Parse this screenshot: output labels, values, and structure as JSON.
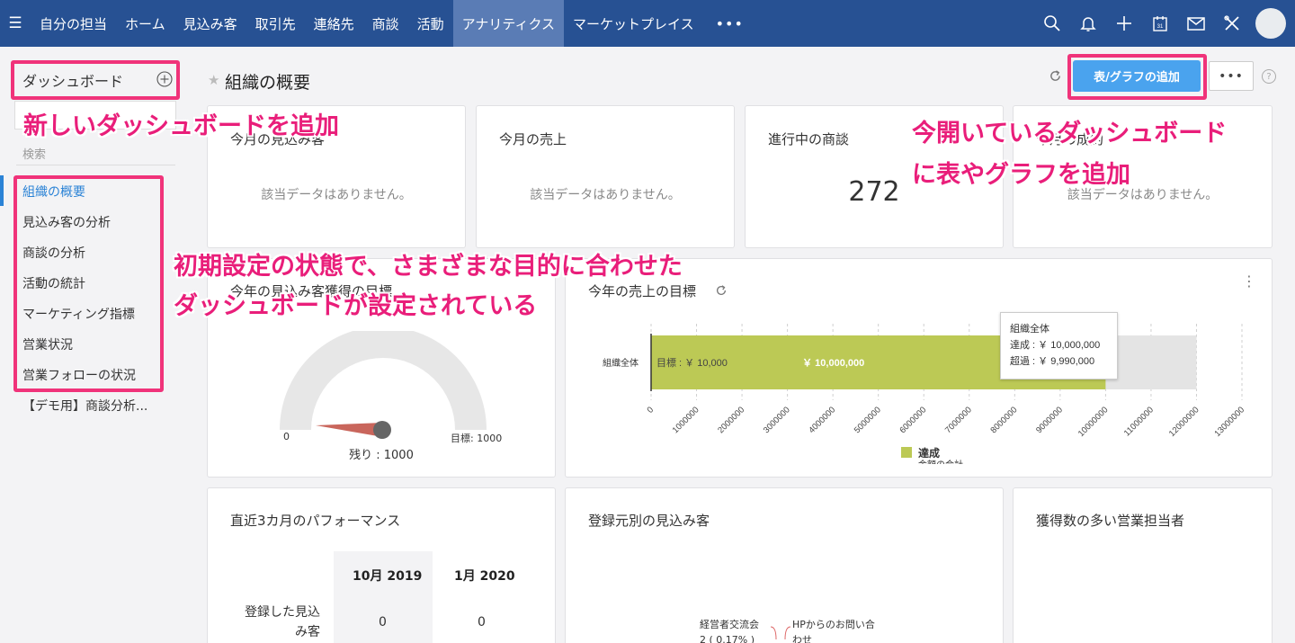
{
  "nav": {
    "items": [
      {
        "label": "自分の担当"
      },
      {
        "label": "ホーム"
      },
      {
        "label": "見込み客"
      },
      {
        "label": "取引先"
      },
      {
        "label": "連絡先"
      },
      {
        "label": "商談"
      },
      {
        "label": "活動"
      },
      {
        "label": "アナリティクス"
      },
      {
        "label": "マーケットプレイス"
      }
    ],
    "more_label": "•••",
    "active_color": "#5a7cb5",
    "bar_color": "#275193"
  },
  "sidebar": {
    "title": "ダッシュボード",
    "search_label": "検索",
    "items": [
      {
        "label": "組織の概要"
      },
      {
        "label": "見込み客の分析"
      },
      {
        "label": "商談の分析"
      },
      {
        "label": "活動の統計"
      },
      {
        "label": "マーケティング指標"
      },
      {
        "label": "営業状況"
      },
      {
        "label": "営業フォローの状況"
      },
      {
        "label": "【デモ用】商談分析..."
      }
    ]
  },
  "header": {
    "star": "★",
    "title": "組織の概要",
    "add_button": "表/グラフの追加",
    "more_button": "•••",
    "help": "?"
  },
  "cards": {
    "leads_month": {
      "title": "今月の見込み客",
      "nodata": "該当データはありません。"
    },
    "sales_month": {
      "title": "今月の売上",
      "nodata": "該当データはありません。"
    },
    "deals_progress": {
      "title": "進行中の商談",
      "value": "272"
    },
    "closed_deals": {
      "title": "今月の成約",
      "nodata": "該当データはありません。"
    },
    "leads_goal": {
      "title": "今年の見込み客獲得の目標",
      "min_label": "0",
      "target_label": "目標: 1000",
      "remaining": "残り : 1000"
    },
    "sales_goal": {
      "title": "今年の売上の目標",
      "row_label": "組織全体",
      "target_text": "目標 : ￥ 10,000",
      "bar_text": "￥ 10,000,000",
      "tooltip_title": "組織全体",
      "tooltip_achieved": "達成 : ￥ 10,000,000",
      "tooltip_excess": "超過 : ￥ 9,990,000",
      "legend_label": "達成",
      "legend_sub": "金額の合計"
    },
    "performance": {
      "title": "直近3カ月のパフォーマンス",
      "col1": "10月 2019",
      "col2": "1月 2020",
      "row_label": "登録した見込み客",
      "val1": "0",
      "val2": "0"
    },
    "lead_source": {
      "title": "登録元別の見込み客",
      "label1_line1": "経営者交流会",
      "label1_line2": "2 ( 0.17% )",
      "label2_line1": "HPからのお問い合",
      "label2_line2": "わせ"
    },
    "top_sales": {
      "title": "獲得数の多い営業担当者"
    }
  },
  "chart_data": {
    "type": "bar",
    "title": "今年の売上の目標",
    "categories": [
      "組織全体"
    ],
    "series": [
      {
        "name": "達成",
        "values": [
          10000000
        ]
      }
    ],
    "target": 10000,
    "xlim": [
      0,
      13000000
    ],
    "xticks": [
      "0",
      "1000000",
      "2000000",
      "3000000",
      "4000000",
      "5000000",
      "6000000",
      "7000000",
      "8000000",
      "9000000",
      "10000000",
      "11000000",
      "12000000",
      "13000000"
    ],
    "bar_color": "#bcc955",
    "background_bar_color": "#e4e4e4",
    "legend_placement": "bottom"
  },
  "annotations": {
    "add_dashboard": "新しいダッシュボードを追加",
    "add_chart_line1": "今開いているダッシュボード",
    "add_chart_line2": "に表やグラフを追加",
    "preset_line1": "初期設定の状態で、さまざまな目的に合わせた",
    "preset_line2": "ダッシュボードが設定されている"
  }
}
